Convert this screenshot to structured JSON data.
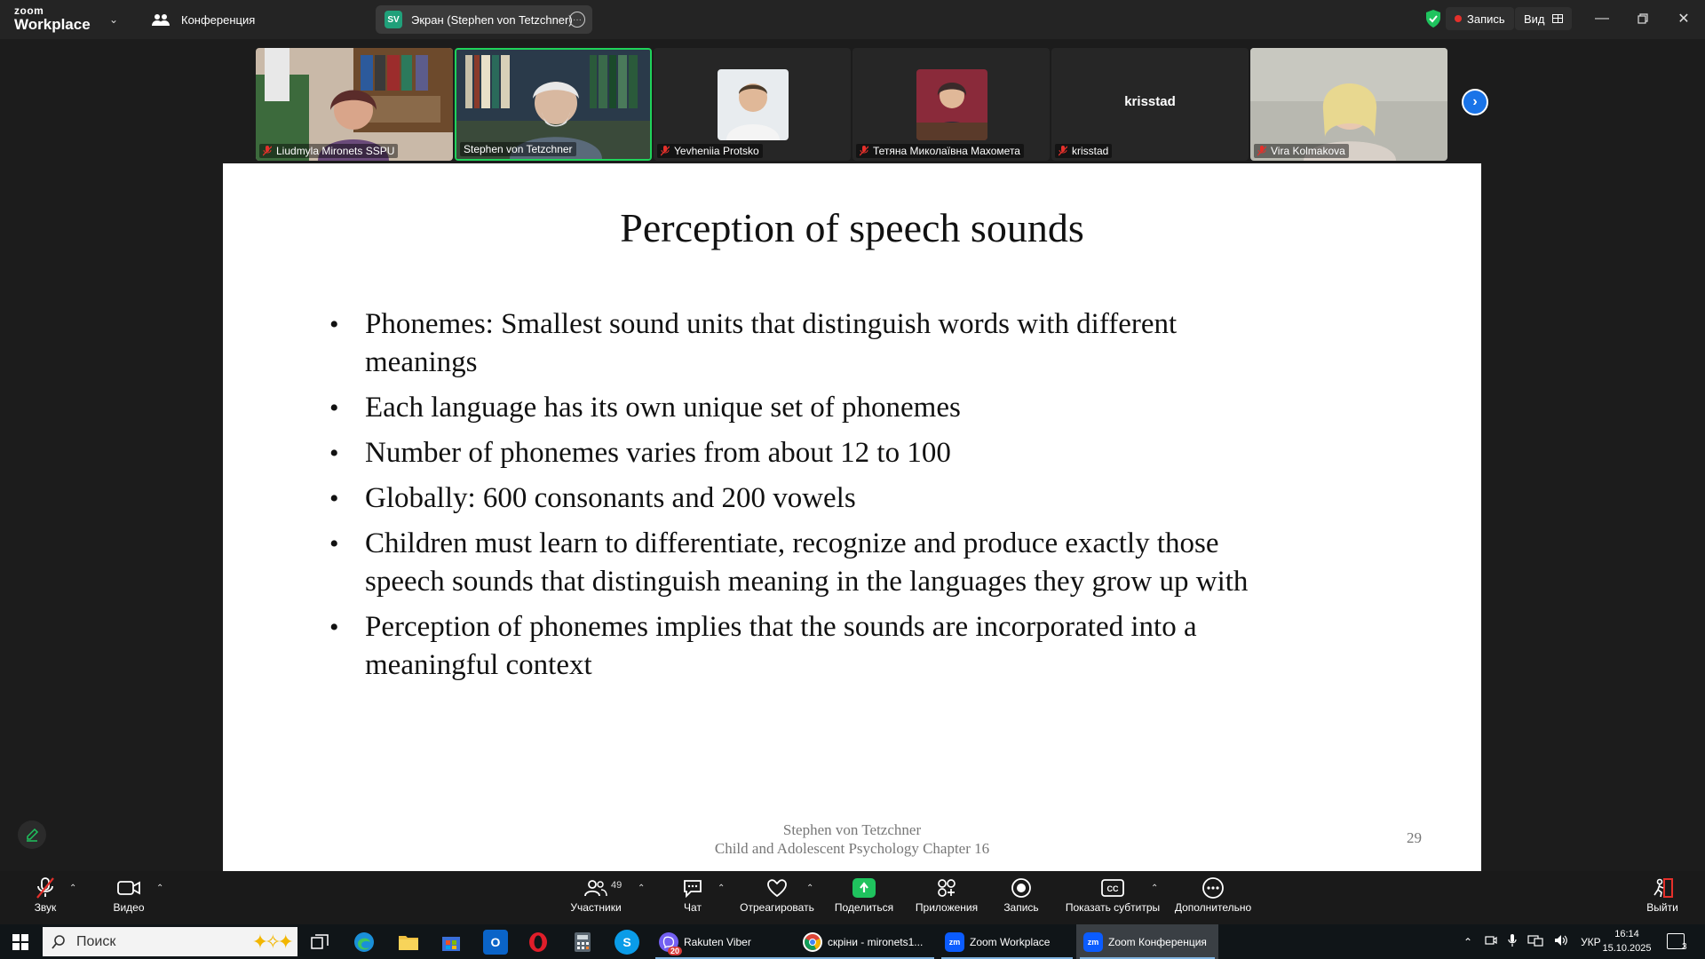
{
  "app": {
    "brand_small": "zoom",
    "brand_big": "Workplace",
    "tabs": [
      {
        "label": "Конференция"
      },
      {
        "label": "Экран (Stephen von Tetzchner)",
        "badge": "SV"
      }
    ],
    "record_label": "Запись",
    "view_label": "Вид",
    "colors": {
      "accent_green": "#1fd35a",
      "record_red": "#e5302b",
      "share_green": "#1fc35e",
      "nav_blue": "#1a74e8"
    }
  },
  "participants": [
    {
      "name": "Liudmyla Mironets SSPU",
      "muted": true
    },
    {
      "name": "Stephen von Tetzchner",
      "muted": false,
      "active_speaker": true
    },
    {
      "name": "Yevheniia Protsko",
      "muted": true
    },
    {
      "name": "Тетяна Миколаївна Махомета",
      "muted": true
    },
    {
      "name": "krisstad",
      "muted": true,
      "display_text": "krisstad"
    },
    {
      "name": "Vira Kolmakova",
      "muted": true
    }
  ],
  "slide": {
    "title": "Perception of speech sounds",
    "bullets": [
      "Phonemes: Smallest sound units that distinguish words with different meanings",
      "Each language has its own unique set of phonemes",
      "Number of phonemes varies from about 12 to 100",
      "Globally: 600 consonants and 200 vowels",
      "Children must learn to differentiate, recognize and produce exactly those speech sounds that distinguish meaning in the languages they grow up with",
      "Perception of phonemes implies that the sounds are incorporated into a meaningful context"
    ],
    "footer_author": "Stephen von Tetzchner",
    "footer_source": "Child and Adolescent Psychology Chapter 16",
    "page_number": "29"
  },
  "controls": {
    "audio": "Звук",
    "video": "Видео",
    "participants": "Участники",
    "participants_count": "49",
    "chat": "Чат",
    "react": "Отреагировать",
    "share": "Поделиться",
    "apps": "Приложения",
    "record": "Запись",
    "captions": "Показать субтитры",
    "more": "Дополнительно",
    "leave": "Выйти"
  },
  "taskbar": {
    "search_placeholder": "Поиск",
    "apps": [
      {
        "label": "Rakuten Viber",
        "badge": "20",
        "icon": "viber-icon"
      },
      {
        "label": "скріни - mironets1...",
        "icon": "chrome-icon"
      },
      {
        "label": "Zoom Workplace",
        "icon": "zoom-icon"
      },
      {
        "label": "Zoom Конференция",
        "icon": "zoom-icon",
        "active": true
      }
    ],
    "language": "УКР",
    "time": "16:14",
    "date": "15.10.2025",
    "notifications": "3"
  }
}
